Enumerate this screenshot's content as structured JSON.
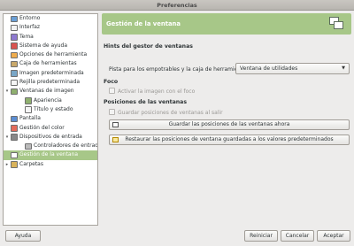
{
  "window": {
    "title": "Preferencias"
  },
  "sidebar": {
    "items": [
      {
        "label": "Entorno",
        "icon": "environment-icon",
        "color": "#6a9fd6",
        "level": 0,
        "expander": ""
      },
      {
        "label": "Interfaz",
        "icon": "interface-icon",
        "color": "#f2f2f2",
        "level": 0,
        "expander": ""
      },
      {
        "label": "Tema",
        "icon": "theme-icon",
        "color": "#8f7ad1",
        "level": 0,
        "expander": ""
      },
      {
        "label": "Sistema de ayuda",
        "icon": "help-icon",
        "color": "#d9534f",
        "level": 0,
        "expander": ""
      },
      {
        "label": "Opciones de herramienta",
        "icon": "tool-options-icon",
        "color": "#f0ad4e",
        "level": 0,
        "expander": ""
      },
      {
        "label": "Caja de herramientas",
        "icon": "toolbox-icon",
        "color": "#c9a86a",
        "level": 0,
        "expander": ""
      },
      {
        "label": "Imagen predeterminada",
        "icon": "default-image-icon",
        "color": "#7aa7c7",
        "level": 0,
        "expander": ""
      },
      {
        "label": "Rejilla predeterminada",
        "icon": "grid-icon",
        "color": "#f5f5f5",
        "level": 0,
        "expander": ""
      },
      {
        "label": "Ventanas de imagen",
        "icon": "image-windows-icon",
        "color": "#8fb06f",
        "level": 0,
        "expander": "▾"
      },
      {
        "label": "Apariencia",
        "icon": "appearance-icon",
        "color": "#8fb06f",
        "level": 1,
        "expander": ""
      },
      {
        "label": "Título y estado",
        "icon": "title-status-icon",
        "color": "#f5f5f5",
        "level": 1,
        "expander": ""
      },
      {
        "label": "Pantalla",
        "icon": "display-icon",
        "color": "#5b8ed3",
        "level": 0,
        "expander": ""
      },
      {
        "label": "Gestión del color",
        "icon": "color-management-icon",
        "color": "#e46b5a",
        "level": 0,
        "expander": ""
      },
      {
        "label": "Dispositivos de entrada",
        "icon": "input-devices-icon",
        "color": "#888888",
        "level": 0,
        "expander": "▾"
      },
      {
        "label": "Controladores de entrada",
        "icon": "input-controllers-icon",
        "color": "#bbbbbb",
        "level": 1,
        "expander": ""
      },
      {
        "label": "Gestión de la ventana",
        "icon": "window-management-icon",
        "color": "#ffffff",
        "level": 0,
        "expander": "",
        "selected": true
      },
      {
        "label": "Carpetas",
        "icon": "folders-icon",
        "color": "#d9b35b",
        "level": 0,
        "expander": "▸"
      }
    ]
  },
  "main": {
    "banner_title": "Gestión de la ventana",
    "hints": {
      "heading": "Hints del gestor de ventanas",
      "label": "Pista para los empotrables y la caja de herramientas:",
      "combo_value": "Ventana de utilidades"
    },
    "focus": {
      "heading": "Foco",
      "checkbox_label": "Activar la imagen con el foco"
    },
    "positions": {
      "heading": "Posiciones de las ventanas",
      "checkbox_label": "Guardar posiciones de ventanas al salir",
      "save_button": "Guardar las posiciones de las ventanas ahora",
      "restore_button": "Restaurar las posiciones de ventana guardadas a los valores predeterminados"
    }
  },
  "footer": {
    "help": "Ayuda",
    "reset": "Reiniciar",
    "cancel": "Cancelar",
    "accept": "Aceptar"
  },
  "colors": {
    "accent": "#a7c788",
    "background": "#edeceb"
  }
}
